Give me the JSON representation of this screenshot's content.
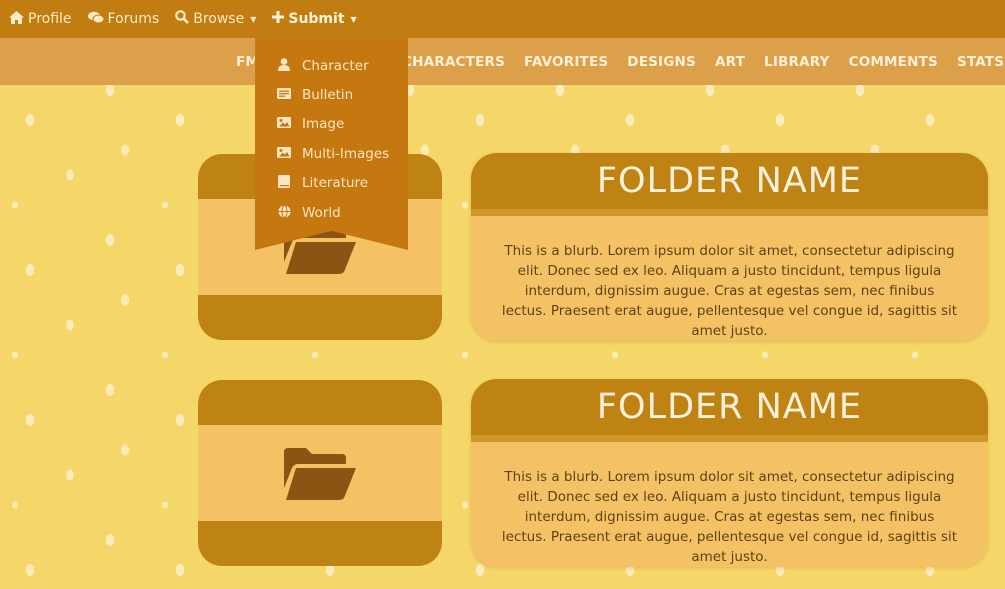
{
  "topbar": {
    "items": [
      {
        "label": "Profile",
        "icon": "home-icon"
      },
      {
        "label": "Forums",
        "icon": "chat-icon"
      },
      {
        "label": "Browse",
        "icon": "search-icon"
      },
      {
        "label": "Submit",
        "icon": "plus-icon"
      }
    ]
  },
  "subnav": {
    "items": [
      "FM",
      "CHARACTERS",
      "FAVORITES",
      "DESIGNS",
      "ART",
      "LIBRARY",
      "COMMENTS",
      "STATS"
    ]
  },
  "submit_menu": {
    "items": [
      {
        "label": "Character",
        "icon": "user-icon"
      },
      {
        "label": "Bulletin",
        "icon": "bulletin-icon"
      },
      {
        "label": "Image",
        "icon": "image-icon"
      },
      {
        "label": "Multi-Images",
        "icon": "images-icon"
      },
      {
        "label": "Literature",
        "icon": "book-icon"
      },
      {
        "label": "World",
        "icon": "globe-icon"
      }
    ]
  },
  "folders": [
    {
      "name": "FOLDER NAME",
      "blurb": "This is a blurb. Lorem ipsum dolor sit amet, consectetur adipiscing elit. Donec sed ex leo. Aliquam a justo tincidunt, tempus ligula interdum, dignissim augue. Cras at egestas sem, nec finibus lectus. Praesent erat augue, pellentesque vel congue id, sagittis sit amet justo."
    },
    {
      "name": "FOLDER NAME",
      "blurb": "This is a blurb. Lorem ipsum dolor sit amet, consectetur adipiscing elit. Donec sed ex leo. Aliquam a justo tincidunt, tempus ligula interdum, dignissim augue. Cras at egestas sem, nec finibus lectus. Praesent erat augue, pellentesque vel congue id, sagittis sit amet justo."
    }
  ],
  "colors": {
    "background": "#f5d668",
    "topbar": "#c17c12",
    "subnav": "#dda04a",
    "card_dark": "#bf8314",
    "card_light": "#f5c165",
    "folder_icon": "#8a5512"
  }
}
